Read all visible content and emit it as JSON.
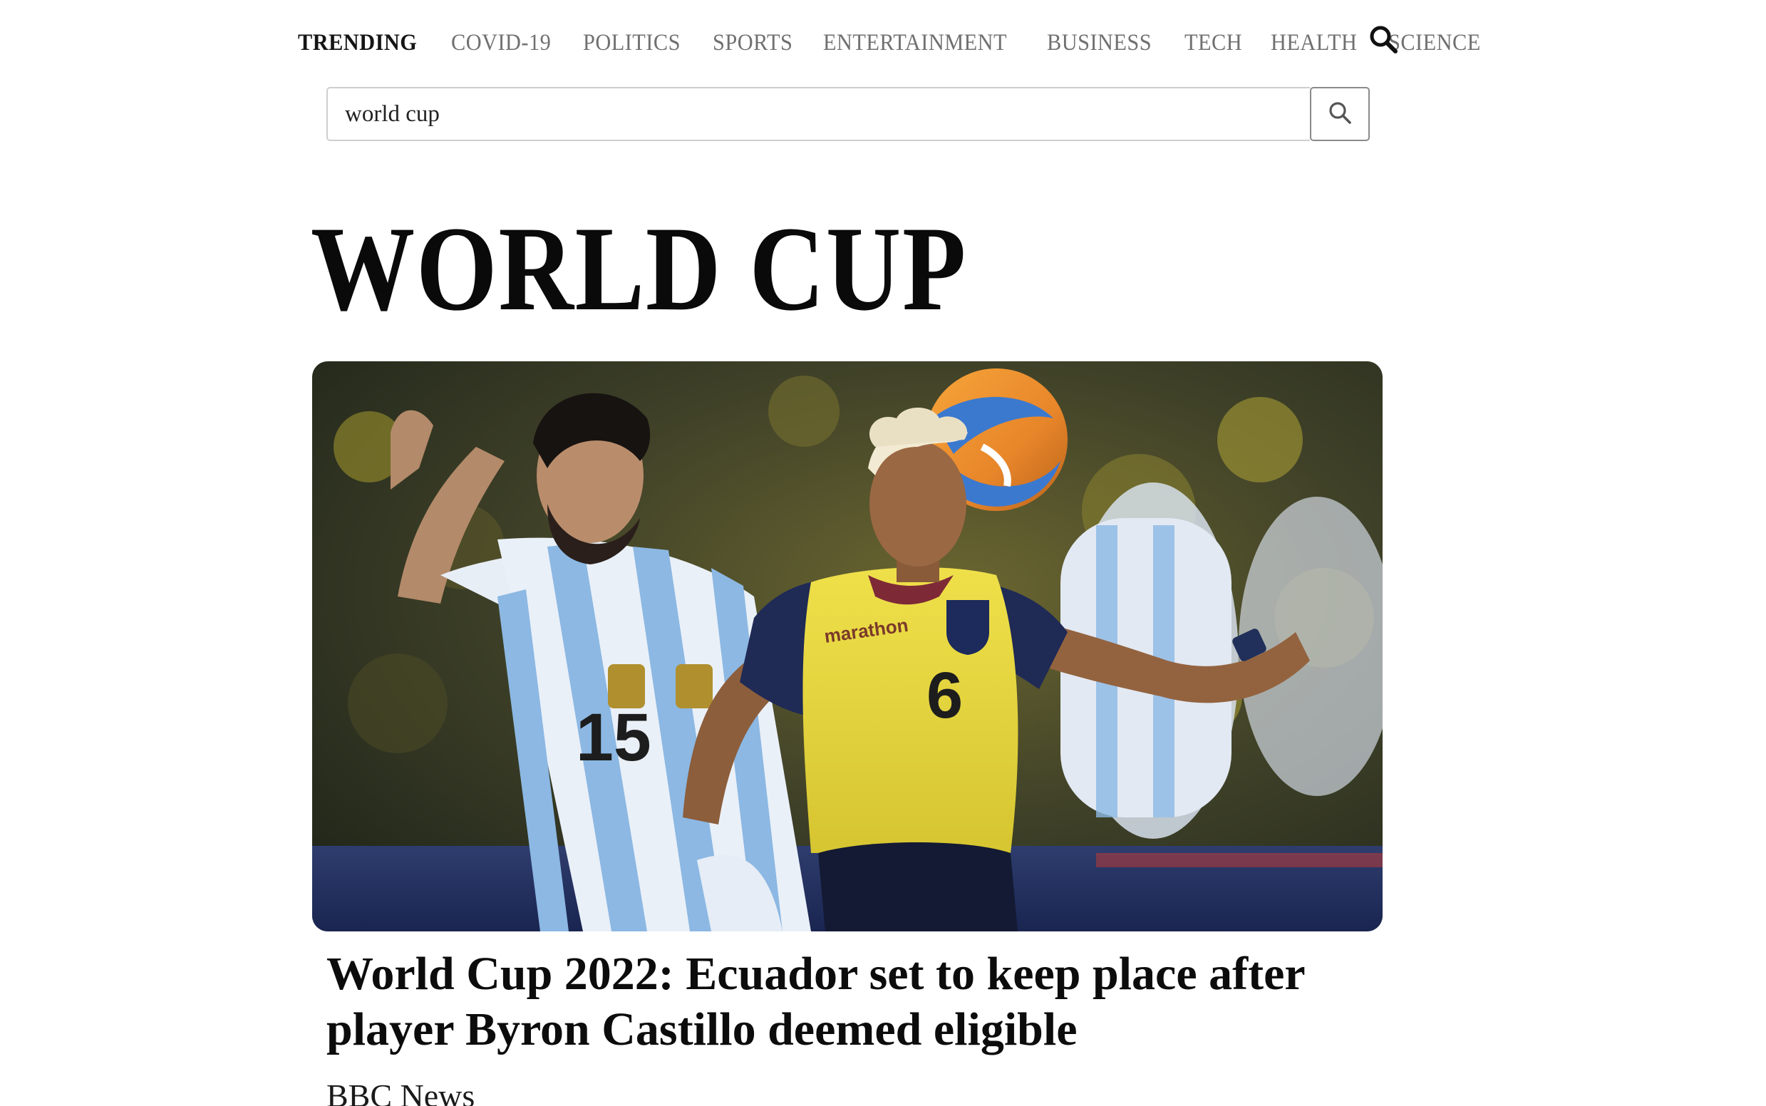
{
  "nav": {
    "items": [
      {
        "label": "TRENDING",
        "active": true
      },
      {
        "label": "COVID-19",
        "active": false
      },
      {
        "label": "POLITICS",
        "active": false
      },
      {
        "label": "SPORTS",
        "active": false
      },
      {
        "label": "ENTERTAINMENT",
        "active": false
      },
      {
        "label": "BUSINESS",
        "active": false
      },
      {
        "label": "TECH",
        "active": false
      },
      {
        "label": "HEALTH",
        "active": false
      },
      {
        "label": "SCIENCE",
        "active": false
      }
    ],
    "search_icon": "search-icon"
  },
  "search": {
    "value": "world cup",
    "button_icon": "search-icon"
  },
  "page": {
    "title": "WORLD CUP"
  },
  "article": {
    "image_alt": "football-match-photo",
    "headline": "World Cup 2022: Ecuador set to keep place after player Byron Castillo deemed eligible",
    "source": "BBC News",
    "jersey_sponsor": "marathon",
    "jersey_number_yellow": "6",
    "jersey_number_white": "15"
  },
  "colors": {
    "nav_active": "#151515",
    "nav_inactive": "#707070",
    "ecuador_yellow": "#ead73a",
    "argentina_blue": "#8cb8e3"
  }
}
